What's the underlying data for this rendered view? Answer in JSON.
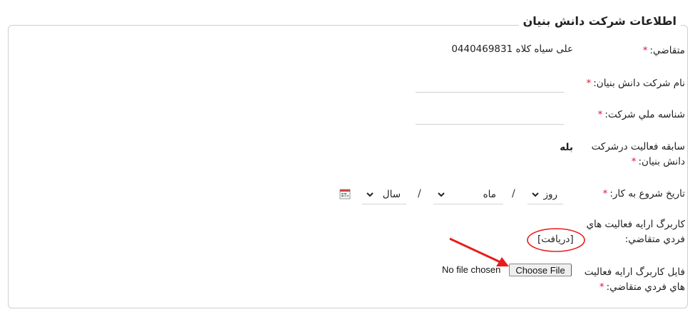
{
  "legend_title": "اطلاعات شرکت دانش بنيان",
  "required_mark": "*",
  "applicant": {
    "label": "متقاضي:",
    "value": "علی سیاه کلاه 0440469831"
  },
  "company_name": {
    "label": "نام شرکت دانش بنيان:",
    "value": ""
  },
  "company_id": {
    "label": "شناسه ملي شرکت:",
    "value": ""
  },
  "activity_history": {
    "label_line1": "سابقه فعاليت درشرکت",
    "label_line2": "دانش بنيان:",
    "value": "بله"
  },
  "start_date": {
    "label": "تاريخ شروع به کار:",
    "day_placeholder": "روز",
    "month_placeholder": "ماه",
    "year_placeholder": "سال",
    "separator": "/"
  },
  "form_activities": {
    "label_line1": "کاربرگ ارايه فعاليت هاي",
    "label_line2": "فردي متقاضي:",
    "link_text": "[دريافت]"
  },
  "form_file": {
    "label_line1": "فايل کاربرگ ارايه فعاليت",
    "label_line2": "هاي فردي متقاضي:",
    "button_label": "Choose File",
    "no_file_text": "No file chosen"
  },
  "colors": {
    "required": "#e0143c",
    "annotation": "#e81c1c",
    "border": "#cfcfcf"
  },
  "icons": {
    "calendar": "calendar-icon",
    "chevron": "chevron-down-icon"
  }
}
